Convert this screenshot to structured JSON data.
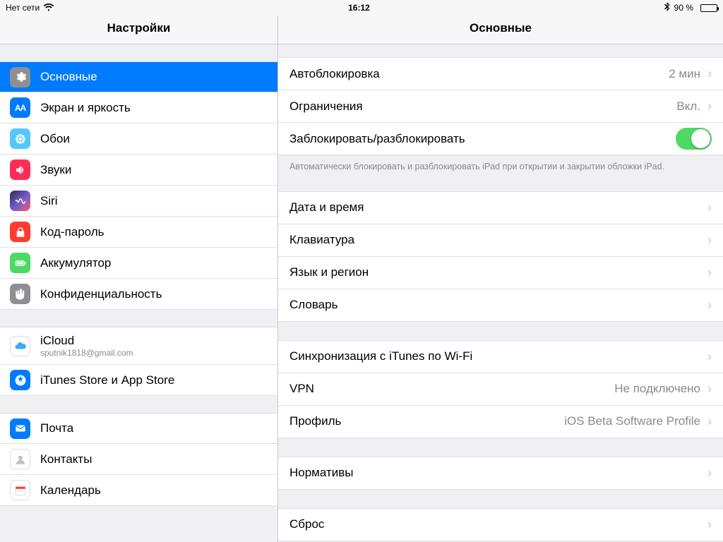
{
  "statusbar": {
    "network": "Нет сети",
    "time": "16:12",
    "battery_pct": "90 %"
  },
  "sidebar": {
    "title": "Настройки",
    "groups": [
      {
        "items": [
          {
            "key": "general",
            "label": "Основные",
            "icon": "gear",
            "bg": "bg-grey",
            "selected": true
          },
          {
            "key": "display",
            "label": "Экран и яркость",
            "icon": "a-a",
            "bg": "bg-blue"
          },
          {
            "key": "wallpaper",
            "label": "Обои",
            "icon": "flower",
            "bg": "bg-cyan"
          },
          {
            "key": "sounds",
            "label": "Звуки",
            "icon": "speaker",
            "bg": "bg-pink"
          },
          {
            "key": "siri",
            "label": "Siri",
            "icon": "siri",
            "bg": "bg-siri"
          },
          {
            "key": "passcode",
            "label": "Код-пароль",
            "icon": "lock",
            "bg": "bg-red"
          },
          {
            "key": "battery",
            "label": "Аккумулятор",
            "icon": "battery",
            "bg": "bg-green"
          },
          {
            "key": "privacy",
            "label": "Конфиденциальность",
            "icon": "hand",
            "bg": "bg-grey"
          }
        ]
      },
      {
        "items": [
          {
            "key": "icloud",
            "label": "iCloud",
            "sublabel": "sputnik1818@gmail.com",
            "icon": "cloud",
            "bg": "bg-white"
          },
          {
            "key": "store",
            "label": "iTunes Store и App Store",
            "icon": "appstore",
            "bg": "bg-blue"
          }
        ]
      },
      {
        "items": [
          {
            "key": "mail",
            "label": "Почта",
            "icon": "mail",
            "bg": "bg-blue"
          },
          {
            "key": "contacts",
            "label": "Контакты",
            "icon": "contact",
            "bg": "bg-white"
          },
          {
            "key": "calendar",
            "label": "Календарь",
            "icon": "calendar",
            "bg": "bg-white"
          }
        ]
      }
    ]
  },
  "detail": {
    "title": "Основные",
    "groups": [
      {
        "rows": [
          {
            "key": "autolock",
            "label": "Автоблокировка",
            "value": "2 мин",
            "chevron": true
          },
          {
            "key": "restrict",
            "label": "Ограничения",
            "value": "Вкл.",
            "chevron": true
          },
          {
            "key": "lockunlock",
            "label": "Заблокировать/разблокировать",
            "switch": true
          }
        ],
        "footer": "Автоматически блокировать и разблокировать iPad при открытии и закрытии обложки iPad."
      },
      {
        "rows": [
          {
            "key": "datetime",
            "label": "Дата и время",
            "chevron": true
          },
          {
            "key": "keyboard",
            "label": "Клавиатура",
            "chevron": true
          },
          {
            "key": "langreg",
            "label": "Язык и регион",
            "chevron": true
          },
          {
            "key": "dict",
            "label": "Словарь",
            "chevron": true
          }
        ]
      },
      {
        "rows": [
          {
            "key": "itunessync",
            "label": "Синхронизация с iTunes по Wi-Fi",
            "chevron": true
          },
          {
            "key": "vpn",
            "label": "VPN",
            "value": "Не подключено",
            "chevron": true
          },
          {
            "key": "profile",
            "label": "Профиль",
            "value": "iOS Beta Software Profile",
            "chevron": true
          }
        ]
      },
      {
        "rows": [
          {
            "key": "regulatory",
            "label": "Нормативы",
            "chevron": true
          }
        ]
      },
      {
        "rows": [
          {
            "key": "reset",
            "label": "Сброс",
            "chevron": true
          }
        ]
      }
    ]
  }
}
